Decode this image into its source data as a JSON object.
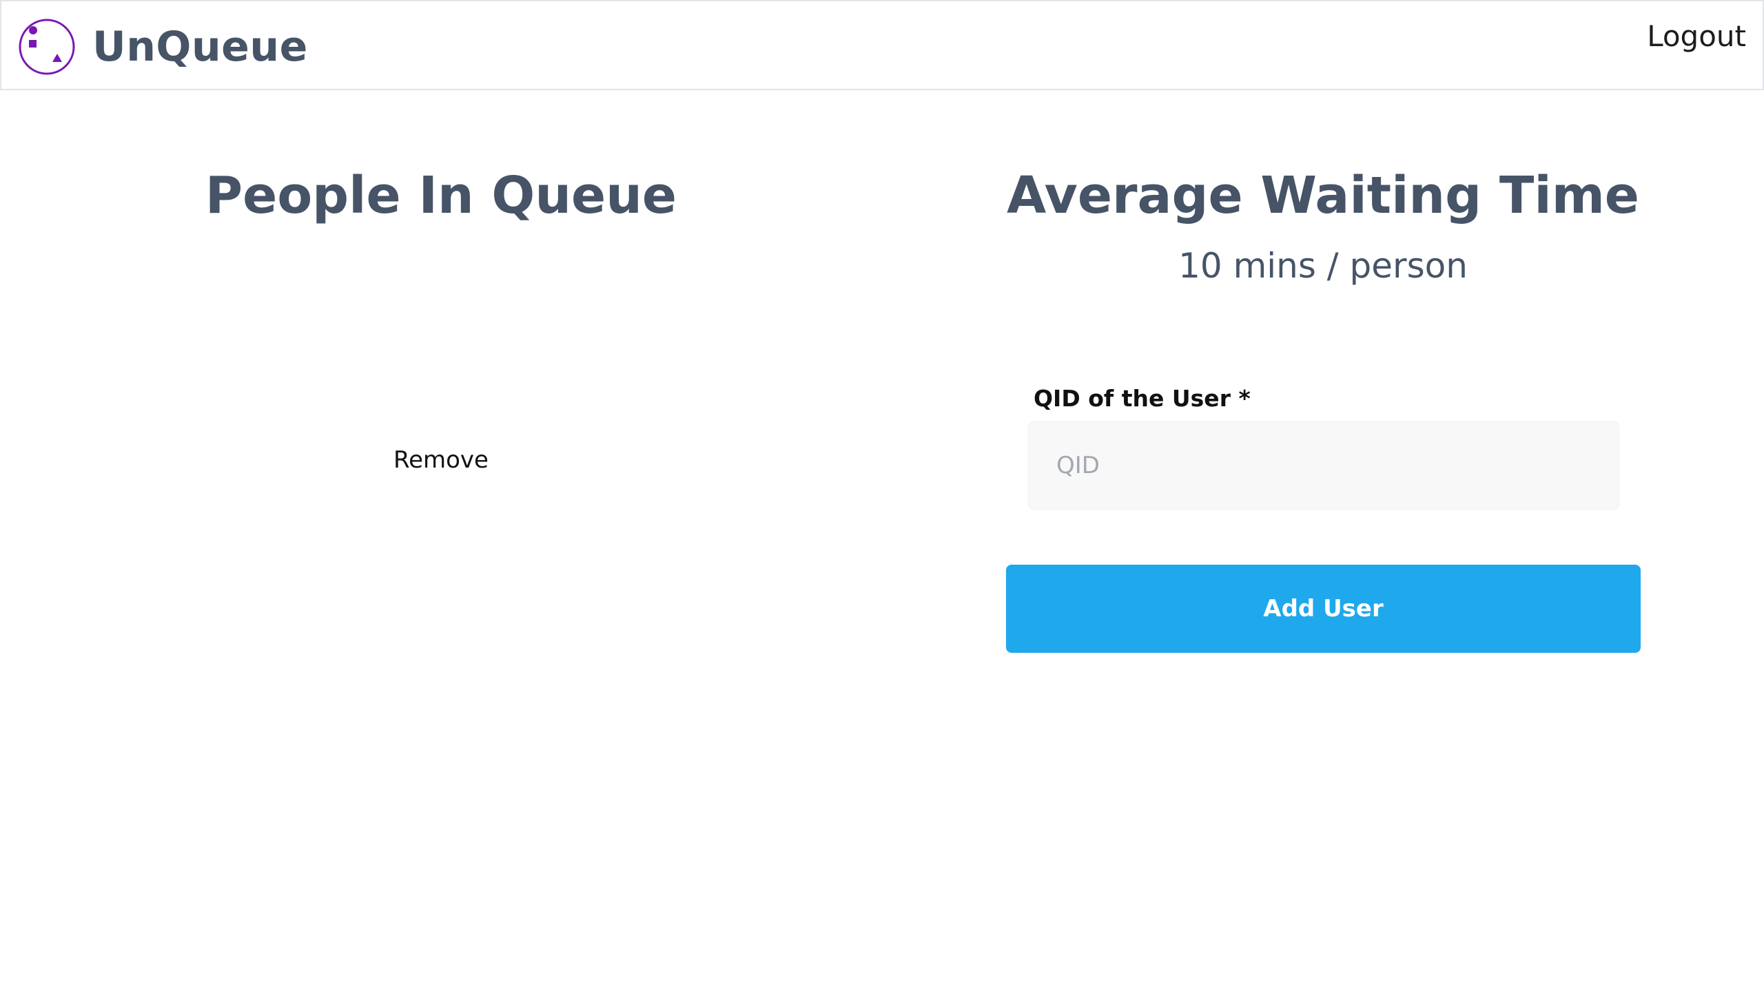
{
  "app": {
    "name": "UnQueue",
    "logo_icon": "queue-shapes-icon",
    "accent_color": "#7b16b5"
  },
  "nav": {
    "logout_label": "Logout"
  },
  "queue": {
    "title": "People In Queue",
    "remove_label": "Remove"
  },
  "waiting": {
    "title": "Average Waiting Time",
    "value": "10 mins / person"
  },
  "form": {
    "label": "QID of the User *",
    "input_value": "",
    "input_placeholder": "QID",
    "submit_label": "Add User",
    "submit_color": "#1fa8ec"
  }
}
